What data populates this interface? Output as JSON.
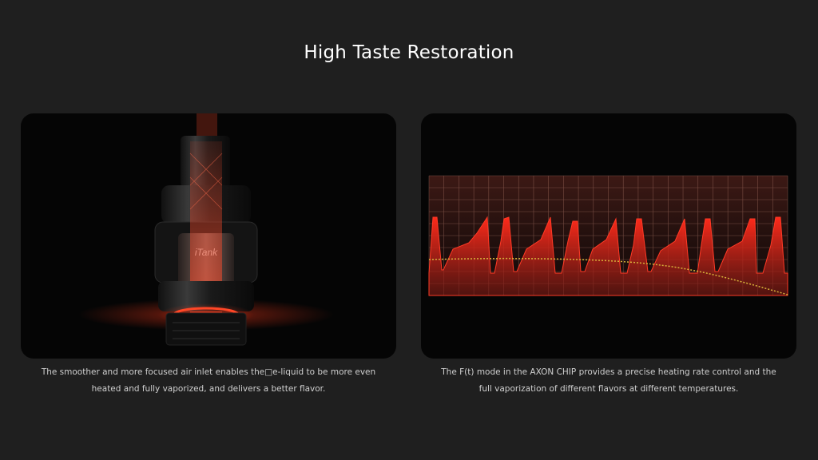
{
  "page": {
    "title": "High Taste Restoration"
  },
  "left_panel": {
    "product_label": "iTank",
    "caption_lines": [
      "The smoother and more focused air inlet enables the□e-liquid to be more even",
      "heated and fully vaporized, and delivers a better flavor."
    ]
  },
  "right_panel": {
    "caption_lines": [
      "The F(t) mode in the AXON CHIP provides a precise heating rate control and the",
      "full vaporization of different flavors at different temperatures."
    ]
  },
  "colors": {
    "background": "#1f1f1f",
    "panel": "#050505",
    "accent_red": "#e0301e",
    "curve_yellow": "#d8b23a"
  }
}
